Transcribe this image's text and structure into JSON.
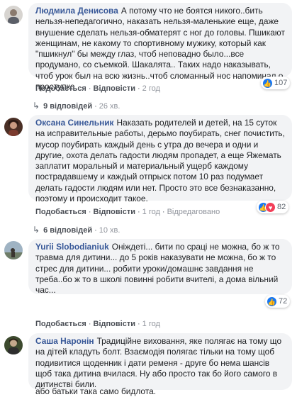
{
  "comments": [
    {
      "author": "Людмила Денисова",
      "text": "А потому что не боятся никого..бить нельзя-непедагогично, наказать нельзя-маленькие еще, даже внушение сделать нельзя-обматерят с ног до головы. Пшикают женщинам, не какому то спортивному мужику, который как \"пшикнул\" бы между глаз, чтоб неповадно было...все продумано, со съемкой. Шакалята.. Таких надо наказывать, чтоб урок был на всю жизнь..чтоб сломанный нос напоминал о проступке.",
      "like_label": "Подобається",
      "reply_label": "Відповісти",
      "time": "2 год",
      "reaction_count": "107",
      "replies_label": "9 відповідей",
      "replies_time": "26 хв."
    },
    {
      "author": "Оксана Синельник",
      "text": "Наказать родителей и детей, на 15 суток на исправительные работы, дерьмо поубирать, снег почистить, мусор поубирать каждый день с утра до вечера и одни и другие, охота делать гадости людям пропадет, а еще Яжемать заплатит моральный и материальный ущерб каждому пострадавшему и каждый отпрыск потом 10 раз подумает делать гадости людям или нет. Просто это все безнаказанно, поэтому и происходит такое.",
      "like_label": "Подобається",
      "reply_label": "Відповісти",
      "time": "1 год",
      "edited_label": "Відредаговано",
      "reaction_count": "82",
      "replies_label": "6 відповідей",
      "replies_time": "10 хв."
    },
    {
      "author": "Yurii Slobodianiuk",
      "text": "Оніждеті... бити по сраці не можна, бо ж то травма для дитини... до 5 років наказувати не можна, бо ж то стрес для дитини... робити уроки/домашнє завдання не треба..бо ж то в школі повинні робити вчителі, а дома вільний час...",
      "like_label": "Подобається",
      "reply_label": "Відповісти",
      "time": "1 год",
      "reaction_count": "72"
    },
    {
      "author": "Саша Наронін",
      "text": "Традиційне виховання, яке полягає на тому що на дітей кладуть болт. Взаємодія полягає тільки на тому щоб подивитися щоденник і дати ременя - друге бо нема шансів щоб така дитина вчилася. Ну або просто так бо його самого в дитинстві били.",
      "footer_text": "або батьки така само бидлота."
    }
  ],
  "colors": {
    "author": "#385898",
    "bubble": "#f2f3f5",
    "like": "#1877f2",
    "love": "#f33e58"
  }
}
